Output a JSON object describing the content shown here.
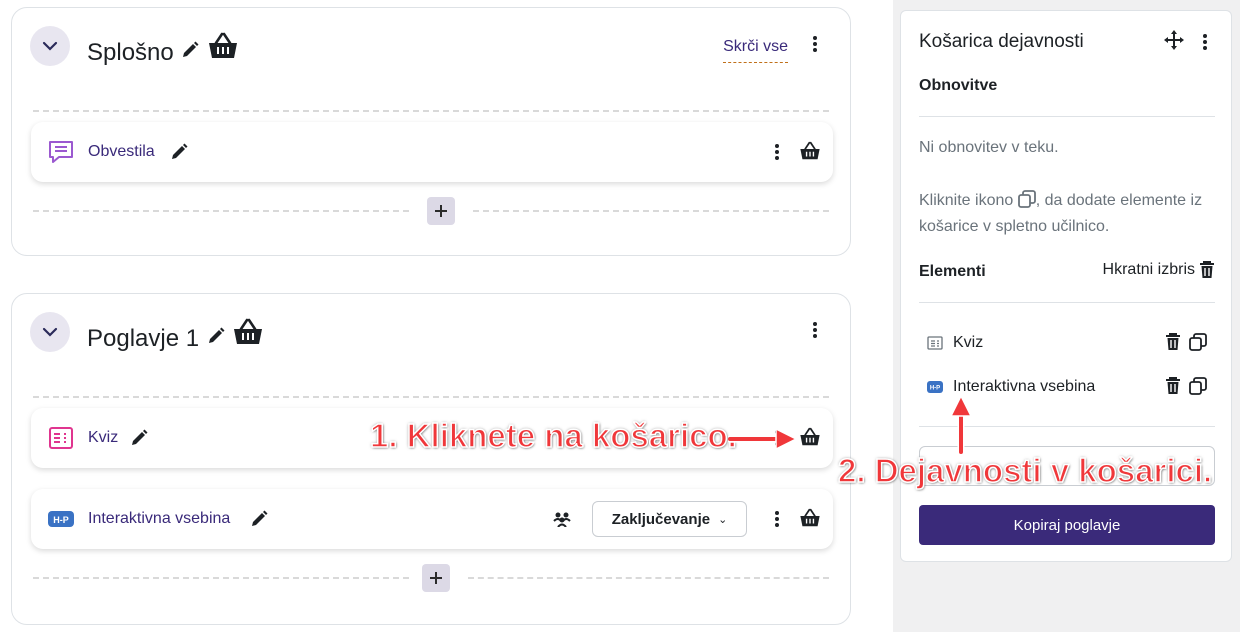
{
  "sections": {
    "general": {
      "title": "Splošno",
      "collapse_all_label": "Skrči vse",
      "activities": [
        {
          "name": "Obvestila",
          "icon": "forum-icon"
        }
      ]
    },
    "chapter1": {
      "title": "Poglavje 1",
      "activities": [
        {
          "name": "Kviz",
          "icon": "quiz-icon"
        },
        {
          "name": "Interaktivna vsebina",
          "icon": "h5p-icon",
          "completion_label": "Zaključevanje"
        }
      ]
    }
  },
  "drawer": {
    "title": "Košarica dejavnosti",
    "updates_heading": "Obnovitve",
    "no_updates_text": "Ni obnovitev v teku.",
    "hint_text_before": "Kliknite ikono",
    "hint_text_after": ", da dodate elemente iz košarice v spletno učilnico.",
    "items_heading": "Elementi",
    "clear_all_label": "Hkratni izbris",
    "items": [
      {
        "name": "Kviz",
        "icon": "quiz-icon"
      },
      {
        "name": "Interaktivna vsebina",
        "icon": "h5p-icon"
      }
    ],
    "copy_section_label": "Kopiraj poglavje"
  },
  "annotations": {
    "step1": "1. Kliknete na košarico.",
    "step2": "2. Dejavnosti v košarici."
  },
  "colors": {
    "brand": "#3a2a7a",
    "annotation": "#f0373a",
    "forum_icon": "#9b59d0",
    "quiz_icon": "#e0358f",
    "h5p_icon": "#3a72c4"
  }
}
